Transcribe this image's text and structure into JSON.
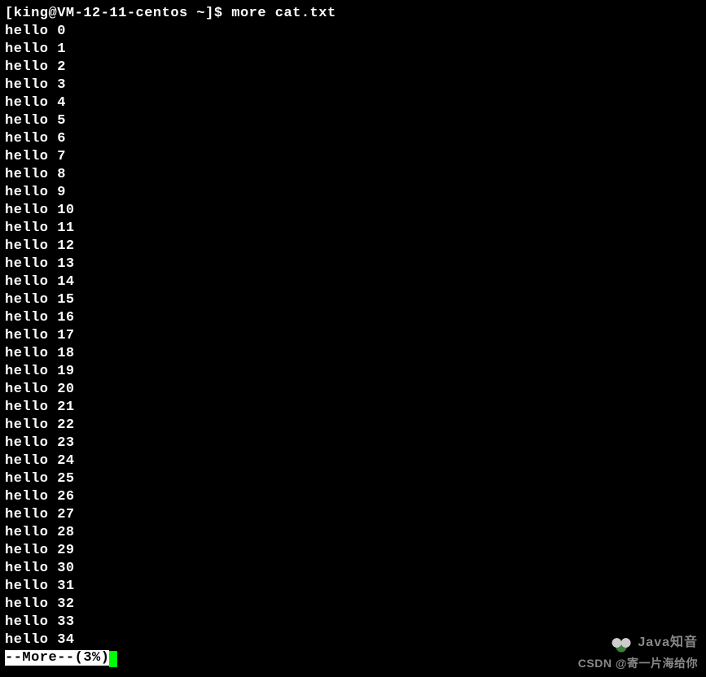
{
  "prompt": "[king@VM-12-11-centos ~]$ more cat.txt",
  "output_lines": [
    "hello 0",
    "hello 1",
    "hello 2",
    "hello 3",
    "hello 4",
    "hello 5",
    "hello 6",
    "hello 7",
    "hello 8",
    "hello 9",
    "hello 10",
    "hello 11",
    "hello 12",
    "hello 13",
    "hello 14",
    "hello 15",
    "hello 16",
    "hello 17",
    "hello 18",
    "hello 19",
    "hello 20",
    "hello 21",
    "hello 22",
    "hello 23",
    "hello 24",
    "hello 25",
    "hello 26",
    "hello 27",
    "hello 28",
    "hello 29",
    "hello 30",
    "hello 31",
    "hello 32",
    "hello 33",
    "hello 34"
  ],
  "more_prompt": "--More--(3%)",
  "watermark_right": "Java知音",
  "watermark_bottom": "CSDN @寄一片海给你"
}
